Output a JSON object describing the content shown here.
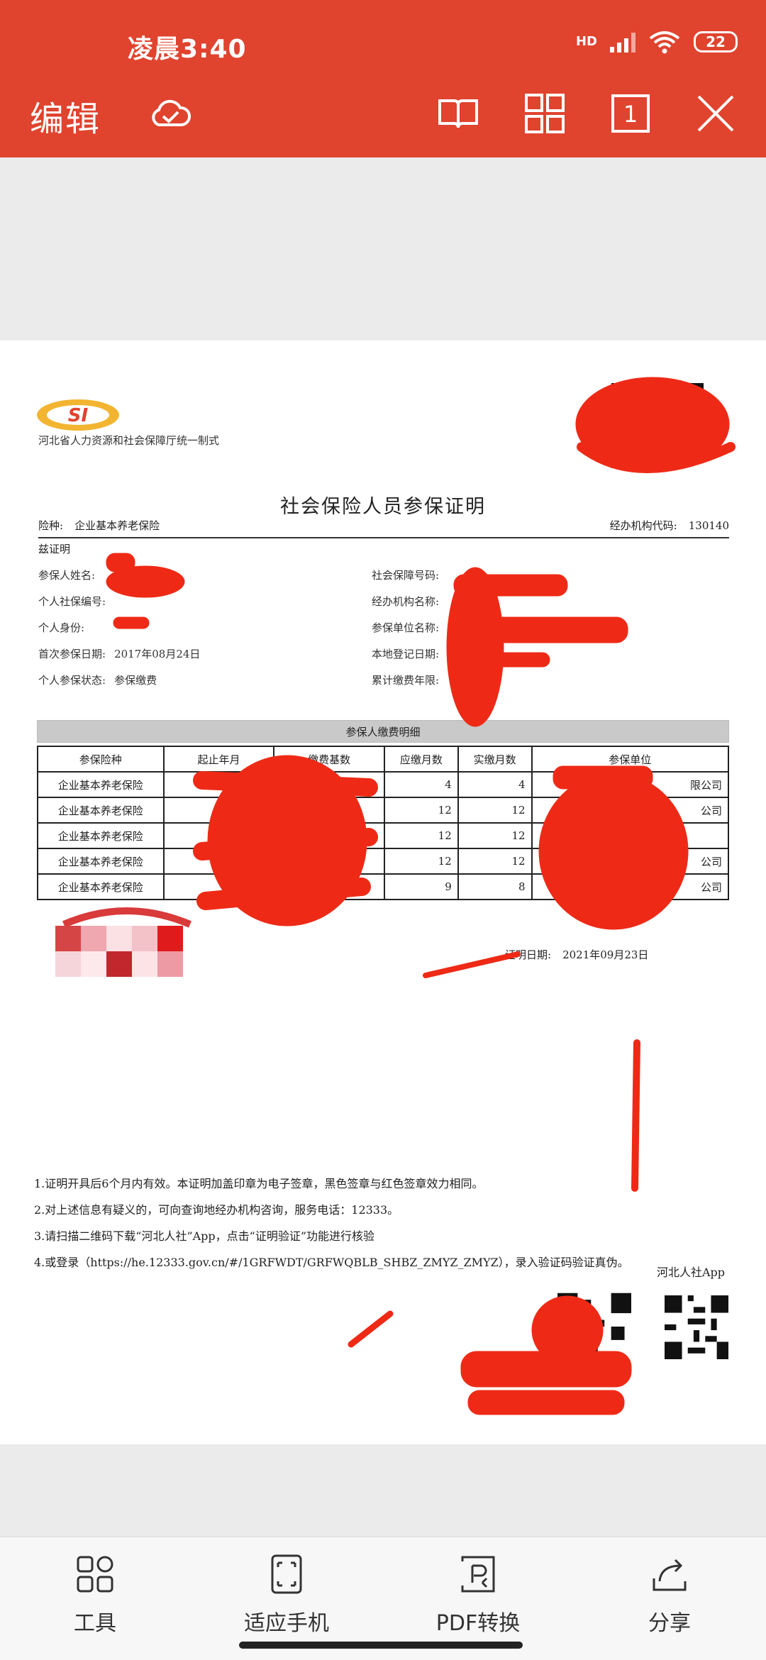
{
  "status": {
    "time": "凌晨3:40",
    "network": "HD",
    "battery": "22"
  },
  "toolbar": {
    "edit_label": "编辑",
    "icons": [
      "cloud-check-icon",
      "book-icon",
      "grid-icon",
      "page-number-icon",
      "close-icon"
    ],
    "page_number": "1"
  },
  "doc": {
    "logo_text": "SI",
    "dept": "河北省人力资源和社会保障厅统一制式",
    "title": "社会保险人员参保证明",
    "insurance_type_label": "险种:",
    "insurance_type": "企业基本养老保险",
    "agency_code_label": "经办机构代码:",
    "agency_code": "130140",
    "intro": "兹证明",
    "fields_left": [
      {
        "label": "参保人姓名:",
        "value": ""
      },
      {
        "label": "个人社保编号:",
        "value": ""
      },
      {
        "label": "个人身份:",
        "value": ""
      },
      {
        "label": "首次参保日期:",
        "value": "2017年08月24日"
      },
      {
        "label": "个人参保状态:",
        "value": "参保缴费"
      }
    ],
    "fields_right": [
      {
        "label": "社会保障号码:",
        "value": ""
      },
      {
        "label": "经办机构名称:",
        "value": ""
      },
      {
        "label": "参保单位名称:",
        "value": ""
      },
      {
        "label": "本地登记日期:",
        "value": ""
      },
      {
        "label": "累计缴费年限:",
        "value": ""
      }
    ],
    "table_title": "参保人缴费明细",
    "table_headers": [
      "参保险种",
      "起止年月",
      "缴费基数",
      "应缴月数",
      "实缴月数",
      "参保单位"
    ],
    "table_rows": [
      [
        "企业基本养老保险",
        "",
        "",
        "4",
        "4",
        "限公司"
      ],
      [
        "企业基本养老保险",
        "",
        "",
        "12",
        "12",
        "公司"
      ],
      [
        "企业基本养老保险",
        "",
        "",
        "12",
        "12",
        ""
      ],
      [
        "企业基本养老保险",
        "",
        "",
        "12",
        "12",
        "公司"
      ],
      [
        "企业基本养老保险",
        "",
        "",
        "9",
        "8",
        "公司"
      ]
    ],
    "cert_date_label": "证明日期:",
    "cert_date": "2021年09月23日",
    "notes": [
      "1.证明开具后6个月内有效。本证明加盖印章为电子签章，黑色签章与红色签章效力相同。",
      "2.对上述信息有疑义的，可向查询地经办机构咨询，服务电话：12333。",
      "3.请扫描二维码下载“河北人社”App，点击“证明验证”功能进行核验",
      "4.或登录（https://he.12333.gov.cn/#/1GRFWDT/GRFWQBLB_SHBZ_ZMYZ_ZMYZ），录入验证码验证真伪。"
    ],
    "qr_label": "河北人社App"
  },
  "bottom": {
    "items": [
      {
        "label": "工具",
        "icon": "tools-icon"
      },
      {
        "label": "适应手机",
        "icon": "fit-screen-icon"
      },
      {
        "label": "PDF转换",
        "icon": "pdf-convert-icon"
      },
      {
        "label": "分享",
        "icon": "share-icon"
      }
    ]
  },
  "colors": {
    "accent": "#e0432e",
    "redaction": "#ee2a16"
  }
}
